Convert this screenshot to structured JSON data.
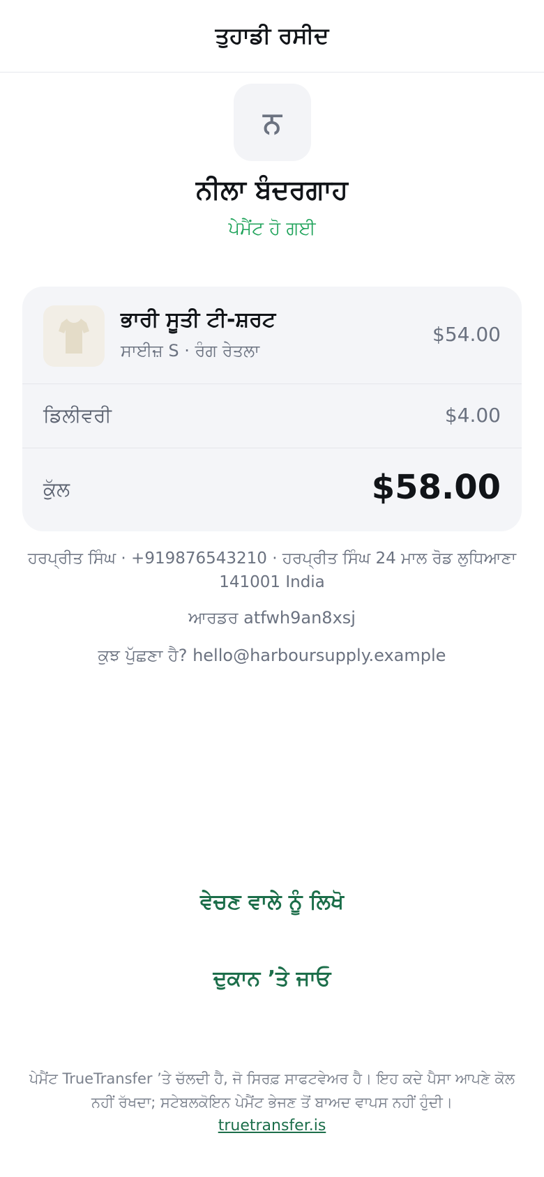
{
  "header": {
    "title": "ਤੁਹਾਡੀ ਰਸੀਦ"
  },
  "merchant": {
    "initial": "ਨ",
    "name": "ਨੀਲਾ ਬੰਦਰਗਾਹ",
    "status": "ਪੇਮੈਂਟ ਹੋ ਗਈ",
    "status_color": "#1fa35a"
  },
  "order_items": [
    {
      "thumbnail_icon": "tshirt-icon",
      "name": "ਭਾਰੀ ਸੂਤੀ ਟੀ-ਸ਼ਰਟ",
      "variant": "ਸਾਈਜ਼ S · ਰੰਗ ਰੇਤਲਾ",
      "price": "$54.00"
    }
  ],
  "delivery": {
    "label": "ਡਿਲੀਵਰੀ",
    "price": "$4.00"
  },
  "total": {
    "label": "ਕੁੱਲ",
    "price": "$58.00"
  },
  "customer": {
    "address_line": "ਹਰਪ੍ਰੀਤ ਸਿੰਘ · +919876543210 · ਹਰਪ੍ਰੀਤ ਸਿੰਘ 24 ਮਾਲ ਰੋਡ ਲੁਧਿਆਣਾ 141001 India"
  },
  "order": {
    "id_line": "ਆਰਡਰ atfwh9an8xsj"
  },
  "support": {
    "line": "ਕੁਝ ਪੁੱਛਣਾ ਹੈ? hello@harboursupply.example"
  },
  "actions": {
    "write_seller": "ਵੇਚਣ ਵਾਲੇ ਨੂੰ ਲਿਖੋ",
    "go_shop": "ਦੁਕਾਨ ’ਤੇ ਜਾਓ",
    "accent_color": "#1c6e4a"
  },
  "footer": {
    "text": "ਪੇਮੈਂਟ TrueTransfer ’ਤੇ ਚੱਲਦੀ ਹੈ, ਜੋ ਸਿਰਫ਼ ਸਾਫਟਵੇਅਰ ਹੈ। ਇਹ ਕਦੇ ਪੈਸਾ ਆਪਣੇ ਕੋਲ ਨਹੀਂ ਰੱਖਦਾ; ਸਟੇਬਲਕੋਇਨ ਪੇਮੈਂਟ ਭੇਜਣ ਤੋਂ ਬਾਅਦ ਵਾਪਸ ਨਹੀਂ ਹੁੰਦੀ।",
    "link": "truetransfer.is"
  }
}
